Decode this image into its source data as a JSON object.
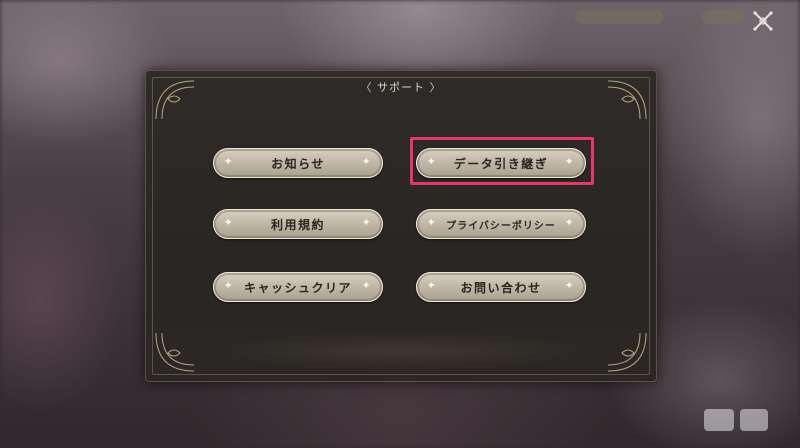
{
  "dialog": {
    "title_open": "〈",
    "title": "サポート",
    "title_close": "〉"
  },
  "buttons": {
    "news": "お知らせ",
    "data_transfer": "データ引き継ぎ",
    "terms": "利用規約",
    "privacy": "プライバシーポリシー",
    "cache_clear": "キャッシュクリア",
    "contact": "お問い合わせ"
  },
  "icons": {
    "close": "close-x-icon",
    "sparkle": "sparkle-icon"
  },
  "colors": {
    "highlight": "#e8356d",
    "panel": "#2c2926",
    "button": "#c9c0af",
    "button_text": "#2c2620"
  }
}
